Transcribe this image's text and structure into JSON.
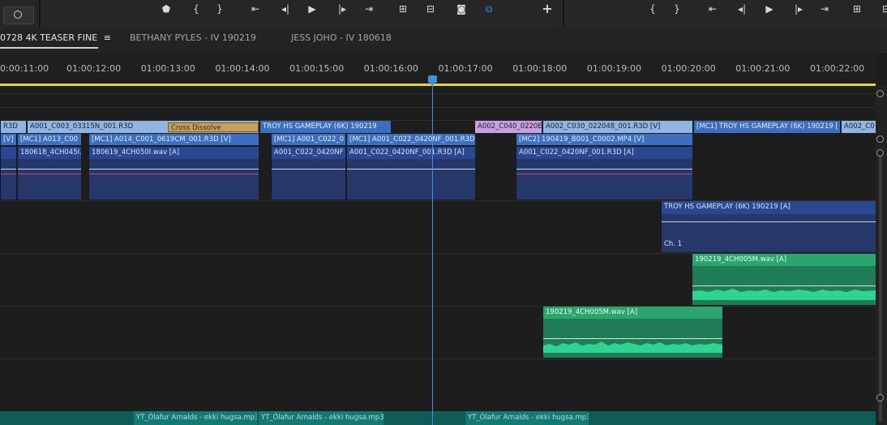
{
  "toolbar": {
    "left_buttons": [
      "marker-icon",
      "mark-in-icon",
      "mark-out-icon",
      "go-to-in-icon",
      "step-back-icon",
      "play-icon",
      "step-forward-icon",
      "go-to-out-icon",
      "insert-icon",
      "overwrite-icon",
      "export-frame-icon",
      "multicam-icon",
      "add-button-icon"
    ],
    "left_glyphs": [
      "⬟",
      "{",
      "}",
      "⇤",
      "◂|",
      "▶",
      "|▸",
      "⇥",
      "⊞",
      "⊟",
      "◙",
      "⧉",
      "+"
    ],
    "right_buttons": [
      "mark-in-icon",
      "mark-out-icon",
      "go-to-in-icon",
      "step-back-icon",
      "play-icon",
      "step-forward-icon",
      "go-to-out-icon",
      "insert-icon",
      "overwrite-icon"
    ],
    "right_glyphs": [
      "{",
      "}",
      "⇤",
      "◂|",
      "▶",
      "|▸",
      "⇥",
      "⊞",
      "⊟"
    ],
    "accent_color": "#2d8ceb"
  },
  "tabs": [
    {
      "label": "0728 4K TEASER FINE",
      "menu": "≡"
    },
    {
      "label": "BETHANY PYLES - IV 190219"
    },
    {
      "label": "JESS JOHO - IV 180618"
    }
  ],
  "ruler": {
    "ticks": [
      "0:00:11:00",
      "01:00:12:00",
      "01:00:13:00",
      "01:00:14:00",
      "01:00:15:00",
      "01:00:16:00",
      "01:00:17:00",
      "01:00:18:00",
      "01:00:19:00",
      "01:00:20:00",
      "01:00:21:00",
      "01:00:22:00"
    ]
  },
  "clips": {
    "v_row1": [
      "R3D",
      "A001_C003_03315N_001.R3D",
      "Cross Dissolve",
      "TROY HS GAMEPLAY (6K) 190219",
      "A002_C040_0220E",
      "A002_C030_022048_001.R3D [V]",
      "[MC1] TROY HS GAMEPLAY (6K) 190219 [",
      "A002_C0"
    ],
    "v_row2": [
      "[V]",
      "[MC1] A013_C00",
      "[MC1] A014_C001_0619CM_001.R3D [V]",
      "[MC1] A001_C022_0",
      "[MC1] A001_C022_0420NF_001.R3D",
      "[MC2] 190419_B001_C0002.MP4 [V]"
    ],
    "a1": [
      "180618_4CH045I.",
      "180619_4CH050I.wav [A]",
      "A001_C022_0420NF",
      "A001_C022_0420NF_001.R3D [A]",
      "A001_C022_0420NF_001.R3D [A]"
    ],
    "a2": {
      "label": "TROY HS GAMEPLAY (6K) 190219 [A]",
      "channel": "Ch. 1"
    },
    "a3": "190219_4CH005M.wav [A]",
    "a4": "190219_4CH005M.wav [A]",
    "music": [
      "YT_Ólafur Arnalds - ekki hugsa.mp3",
      "YT_Ólafur Arnalds - ekki hugsa.mp3",
      "YT_Ólafur Arnalds - ekki hugsa.mp3"
    ]
  }
}
